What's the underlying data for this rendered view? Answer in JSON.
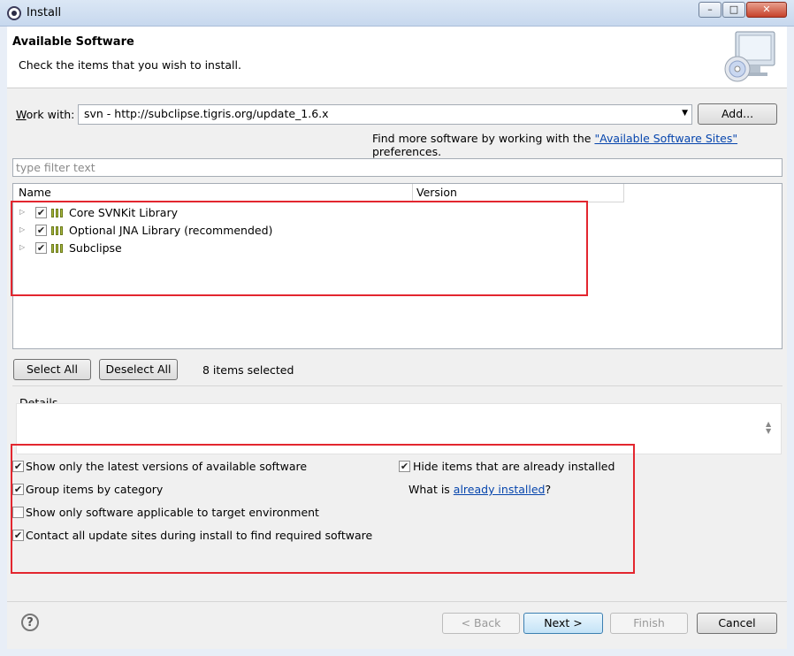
{
  "window": {
    "title": "Install",
    "minimize_glyph": "–",
    "maximize_glyph": "□",
    "close_glyph": "✕"
  },
  "header": {
    "title": "Available Software",
    "description": "Check the items that you wish to install."
  },
  "work_with": {
    "label_prefix": "W",
    "label_rest": "ork with:",
    "value": "svn - http://subclipse.tigris.org/update_1.6.x",
    "add_button": "Add..."
  },
  "sites_hint": {
    "prefix": "Find more software by working with the ",
    "link": "\"Available Software Sites\"",
    "suffix": " preferences."
  },
  "filter": {
    "placeholder": "type filter text"
  },
  "table": {
    "columns": [
      "Name",
      "Version"
    ],
    "rows": [
      {
        "label": "Core SVNKit Library",
        "checked": true
      },
      {
        "label": "Optional JNA Library (recommended)",
        "checked": true
      },
      {
        "label": "Subclipse",
        "checked": true
      }
    ]
  },
  "selection": {
    "select_all": "Select All",
    "deselect_all": "Deselect All",
    "status": "8 items selected"
  },
  "details": {
    "label": "Details"
  },
  "options": {
    "latest_versions": {
      "label": "Show only the latest versions of available software",
      "checked": true
    },
    "group_by_category": {
      "label": "Group items by category",
      "checked": true
    },
    "target_env": {
      "label": "Show only software applicable to target environment",
      "checked": false
    },
    "contact_sites": {
      "label": "Contact all update sites during install to find required software",
      "checked": true
    },
    "hide_installed": {
      "label": "Hide items that are already installed",
      "checked": true
    },
    "what_is_prefix": "What is ",
    "what_is_link": "already installed",
    "what_is_suffix": "?"
  },
  "footer": {
    "help_glyph": "?",
    "back": "< Back",
    "next": "Next >",
    "finish": "Finish",
    "cancel": "Cancel"
  },
  "colors": {
    "highlight_box": "#e3262f",
    "link": "#0645ad"
  }
}
